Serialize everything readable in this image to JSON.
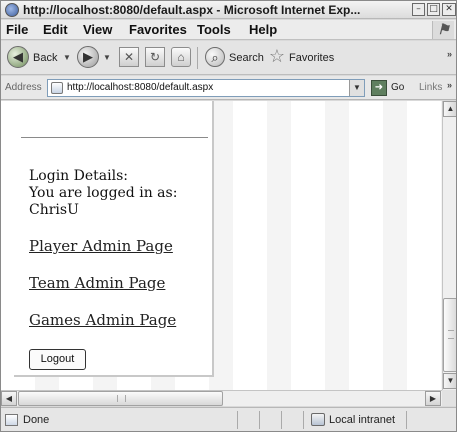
{
  "window": {
    "title": "http://localhost:8080/default.aspx - Microsoft Internet Exp...",
    "minimize": "–",
    "maximize": "□",
    "close": "✕"
  },
  "menu": {
    "items": [
      {
        "label": "File",
        "icon": ""
      },
      {
        "label": "Edit"
      },
      {
        "label": "View"
      },
      {
        "label": "Favorites"
      },
      {
        "label": "Tools"
      },
      {
        "label": "Help"
      }
    ]
  },
  "toolbar": {
    "back_label": "Back",
    "search_label": "Search",
    "favorites_label": "Favorites",
    "back_icon": "back-arrow-icon",
    "forward_icon": "forward-arrow-icon",
    "stop_icon": "stop-icon",
    "refresh_icon": "refresh-icon",
    "home_icon": "home-icon",
    "search_icon": "search-icon",
    "favorites_icon": "favorites-star-icon"
  },
  "address": {
    "label": "Address",
    "url": "http://localhost:8080/default.aspx",
    "go_label": "Go",
    "links_label": "Links"
  },
  "page": {
    "login_details_label": "Login Details:",
    "logged_in_as_label": "You are logged in as:",
    "username": "ChrisU",
    "links": [
      {
        "label": "Player Admin Page"
      },
      {
        "label": "Team Admin Page"
      },
      {
        "label": "Games Admin Page"
      }
    ],
    "logout_label": "Logout"
  },
  "statusbar": {
    "status": "Done",
    "zone": "Local intranet"
  }
}
